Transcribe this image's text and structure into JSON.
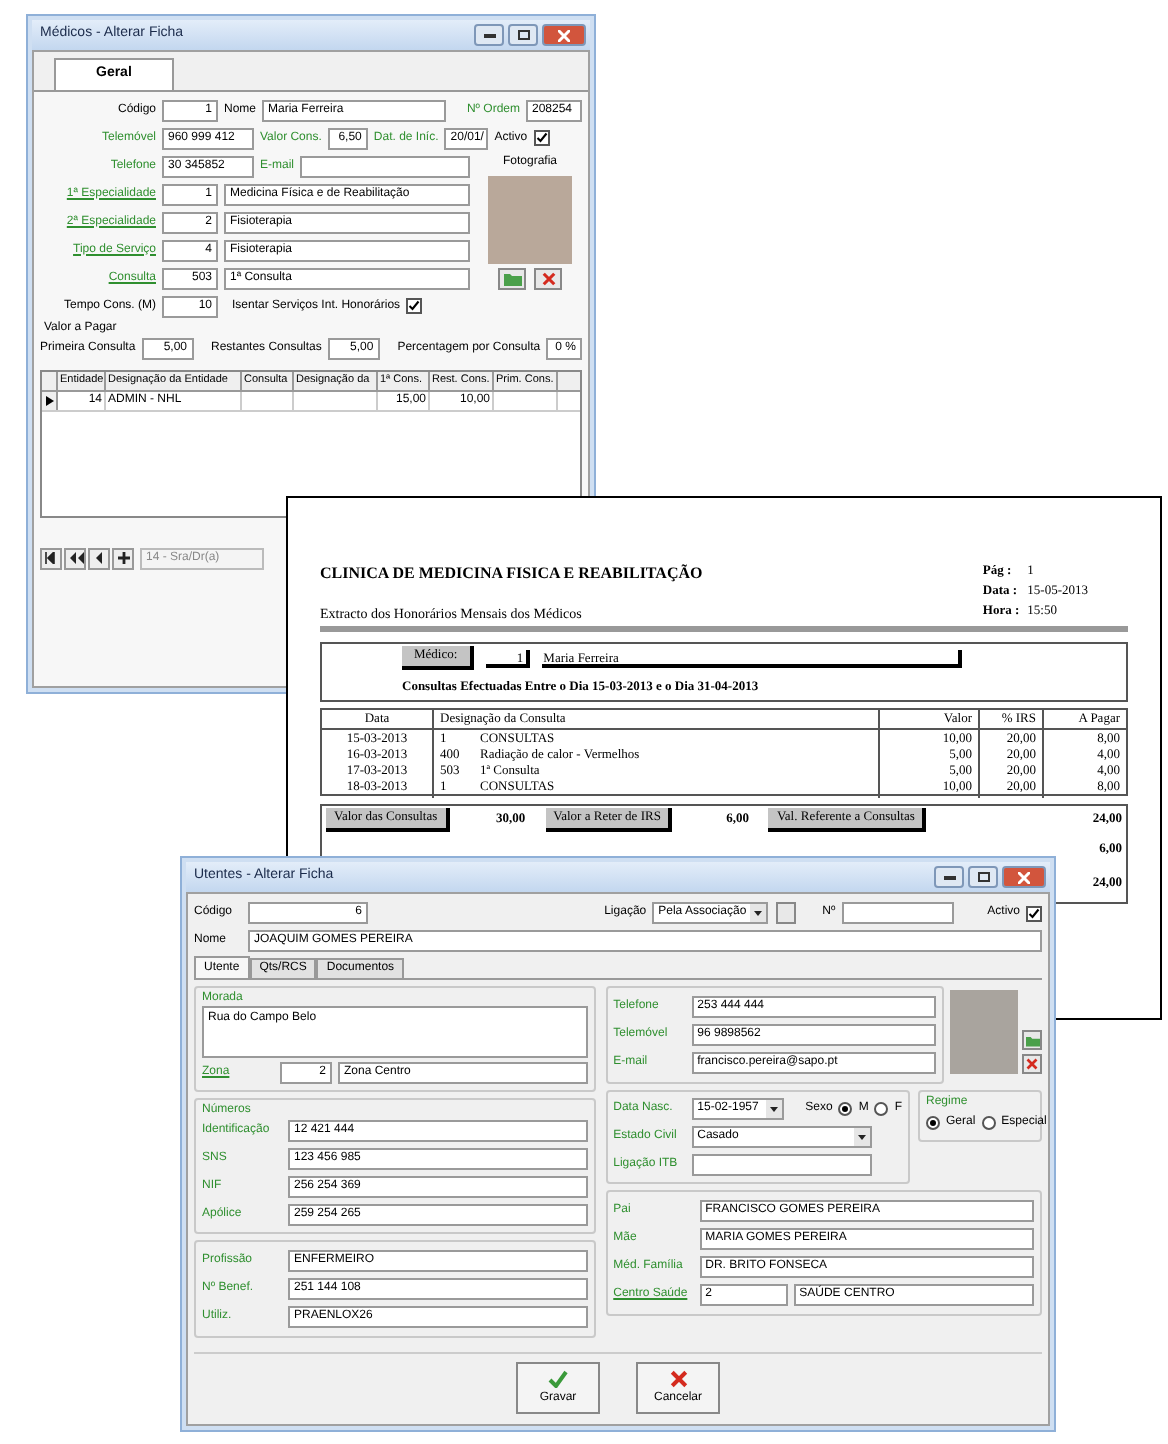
{
  "doctor_window": {
    "title": "Médicos - Alterar Ficha",
    "tab": {
      "label": "Geral",
      "selected": true
    },
    "code": {
      "label": "Código",
      "value": "1",
      "kind": "plain"
    },
    "name": {
      "label": "Nome",
      "value": "Maria Ferreira",
      "kind": "plain"
    },
    "order_no": {
      "label": "Nº Ordem",
      "value": "208254",
      "kind": "green"
    },
    "mobile": {
      "label": "Telemóvel",
      "value": "960 999 412",
      "kind": "green"
    },
    "consult_value": {
      "label": "Valor Cons.",
      "value": "6,50",
      "kind": "green"
    },
    "start_date": {
      "label": "Dat. de Iníc.",
      "value": "20/01/",
      "kind": "green"
    },
    "active": {
      "label": "Activo",
      "checked": true
    },
    "phone": {
      "label": "Telefone",
      "value": "30 345852",
      "kind": "green"
    },
    "email": {
      "label": "E-mail",
      "kind": "green"
    },
    "lookups": [
      {
        "label": "1ª Especialidade",
        "code": "1",
        "text": "Medicina Física e de Reabilitação",
        "kind": "link"
      },
      {
        "label": "2ª Especialidade",
        "code": "2",
        "text": "Fisioterapia",
        "kind": "link"
      },
      {
        "label": "Tipo de Serviço",
        "code": "4",
        "text": "Fisioterapia",
        "kind": "link"
      },
      {
        "label": "Consulta",
        "code": "503",
        "text": "1ª Consulta",
        "kind": "link"
      }
    ],
    "consult_time": {
      "label": "Tempo Cons. (M)",
      "value": "10",
      "kind": "plain"
    },
    "exempt": {
      "label": "Isentar Serviços Int. Honorários",
      "checked": true
    },
    "pay_heading": "Valor a Pagar",
    "pay_fields": [
      {
        "label": "Primeira Consulta",
        "value": "5,00",
        "kind": "plain"
      },
      {
        "label": "Restantes Consultas",
        "value": "5,00",
        "kind": "plain"
      },
      {
        "label": "Percentagem por Consulta",
        "value": "0 %",
        "kind": "plain"
      }
    ],
    "photo_label": "Fotografia",
    "table": {
      "columns": [
        "Entidade",
        "Designação da Entidade",
        "Consulta",
        "Designação da",
        "1ª Cons.",
        "Rest. Cons.",
        "Prim. Cons."
      ],
      "rows": [
        {
          "selected": true,
          "entity": "14",
          "entity_name": "ADMIN - NHL",
          "first": "15,00",
          "rest": "10,00"
        }
      ]
    },
    "navigator_text": "14 - Sra/Dr(a)"
  },
  "report": {
    "title": "CLINICA DE MEDICINA FISICA E REABILITAÇÃO",
    "subtitle": "Extracto dos Honorários Mensais dos Médicos",
    "meta": [
      {
        "label": "Pág :",
        "value": "1"
      },
      {
        "label": "Data :",
        "value": "15-05-2013"
      },
      {
        "label": "Hora :",
        "value": "15:50"
      }
    ],
    "doctor_label": "Médico:",
    "doctor_code": "1",
    "doctor_name": "Maria Ferreira",
    "period": "Consultas Efectuadas Entre o Dia 15-03-2013 e o Dia 31-04-2013",
    "columns": [
      "Data",
      "Designação da Consulta",
      "Valor",
      "% IRS",
      "A Pagar"
    ],
    "rows": [
      {
        "date": "15-03-2013",
        "code": "1",
        "text": "CONSULTAS",
        "value": "10,00",
        "irs": "20,00",
        "pay": "8,00"
      },
      {
        "date": "16-03-2013",
        "code": "400",
        "text": "Radiação de calor - Vermelhos",
        "value": "5,00",
        "irs": "20,00",
        "pay": "4,00"
      },
      {
        "date": "17-03-2013",
        "code": "503",
        "text": "1ª Consulta",
        "value": "5,00",
        "irs": "20,00",
        "pay": "4,00"
      },
      {
        "date": "18-03-2013",
        "code": "1",
        "text": "CONSULTAS",
        "value": "10,00",
        "irs": "20,00",
        "pay": "8,00"
      }
    ],
    "totals": [
      {
        "label": "Valor das Consultas",
        "value": "30,00"
      },
      {
        "label": "Valor a Reter de IRS",
        "value": "6,00"
      },
      {
        "label": "Val. Referente a Consultas",
        "value": "24,00"
      }
    ],
    "extra_totals": [
      "6,00",
      "24,00"
    ]
  },
  "patient_window": {
    "title": "Utentes - Alterar Ficha",
    "code": {
      "label": "Código",
      "value": "6",
      "kind": "plain"
    },
    "link": {
      "label": "Ligação",
      "value": "Pela Associação",
      "kind": "plain"
    },
    "number": {
      "label": "Nº",
      "kind": "plain"
    },
    "active": {
      "label": "Activo",
      "checked": true
    },
    "name": {
      "label": "Nome",
      "value": "JOAQUIM GOMES PEREIRA",
      "kind": "plain"
    },
    "tabs": [
      {
        "label": "Utente",
        "selected": true
      },
      {
        "label": "Qts/RCS",
        "selected": false
      },
      {
        "label": "Documentos",
        "selected": false
      }
    ],
    "address": {
      "heading": "Morada",
      "value": "Rua do Campo Belo",
      "zone": {
        "label": "Zona",
        "code": "2",
        "text": "Zona Centro",
        "kind": "link"
      }
    },
    "numbers": {
      "heading": "Números",
      "fields": [
        {
          "label": "Identificação",
          "value": "12 421 444",
          "kind": "green"
        },
        {
          "label": "SNS",
          "value": "123 456 985",
          "kind": "green"
        },
        {
          "label": "NIF",
          "value": "256 254 369",
          "kind": "green"
        },
        {
          "label": "Apólice",
          "value": "259 254 265",
          "kind": "green"
        }
      ]
    },
    "work_fields": [
      {
        "label": "Profissão",
        "value": "ENFERMEIRO",
        "kind": "green"
      },
      {
        "label": "Nº Benef.",
        "value": "251 144 108",
        "kind": "green"
      },
      {
        "label": "Utiliz.",
        "value": "PRAENLOX26",
        "kind": "green"
      }
    ],
    "contacts": [
      {
        "label": "Telefone",
        "value": "253 444 444",
        "kind": "green"
      },
      {
        "label": "Telemóvel",
        "value": "96 9898562",
        "kind": "green"
      },
      {
        "label": "E-mail",
        "value": "francisco.pereira@sapo.pt",
        "kind": "green"
      }
    ],
    "birth": {
      "label": "Data Nasc.",
      "value": "15-02-1957",
      "kind": "green"
    },
    "sex": {
      "label": "Sexo",
      "options": [
        {
          "label": "M",
          "selected": true
        },
        {
          "label": "F",
          "selected": false
        }
      ]
    },
    "regime": {
      "heading": "Regime",
      "options": [
        {
          "label": "Geral",
          "selected": true
        },
        {
          "label": "Especial",
          "selected": false
        }
      ]
    },
    "civil": {
      "label": "Estado Civil",
      "value": "Casado",
      "kind": "green"
    },
    "itb": {
      "label": "Ligação ITB",
      "kind": "green"
    },
    "family": [
      {
        "label": "Pai",
        "value": "FRANCISCO GOMES PEREIRA",
        "kind": "green"
      },
      {
        "label": "Mãe",
        "value": "MARIA GOMES PEREIRA",
        "kind": "green"
      },
      {
        "label": "Méd. Família",
        "value": "DR. BRITO FONSECA",
        "kind": "green"
      }
    ],
    "health_center": {
      "label": "Centro Saúde",
      "code": "2",
      "text": "SAÚDE CENTRO",
      "kind": "link"
    },
    "buttons": [
      {
        "label": "Gravar",
        "kind": "save"
      },
      {
        "label": "Cancelar",
        "kind": "cancel"
      }
    ]
  }
}
